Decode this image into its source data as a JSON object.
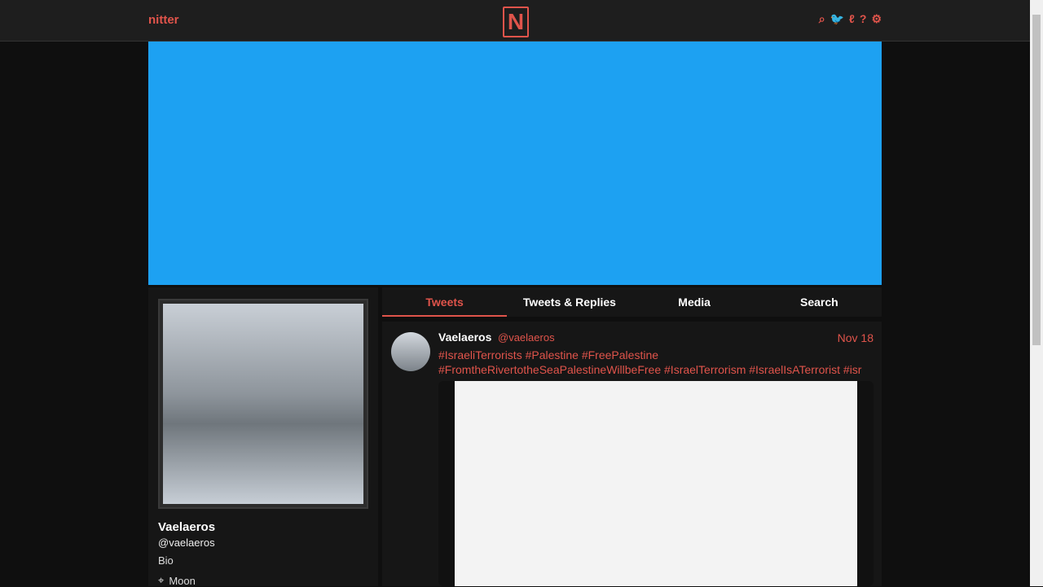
{
  "nav": {
    "brand": "nitter",
    "logo": "N",
    "icons": [
      "search-icon",
      "twitter-icon",
      "lp-icon",
      "help-icon",
      "settings-icon"
    ]
  },
  "profile": {
    "name": "Vaelaeros",
    "handle": "@vaelaeros",
    "bio": "Bio",
    "location": "Moon"
  },
  "tabs": [
    "Tweets",
    "Tweets & Replies",
    "Media",
    "Search"
  ],
  "tweet": {
    "name": "Vaelaeros",
    "handle": "@vaelaeros",
    "date": "Nov 18",
    "text": "#IsraeliTerrorists #Palestine #FreePalestine #FromtheRivertotheSeaPalestineWillbeFree #IsraelTerrorism #IsraelIsATerrorist #isr"
  }
}
